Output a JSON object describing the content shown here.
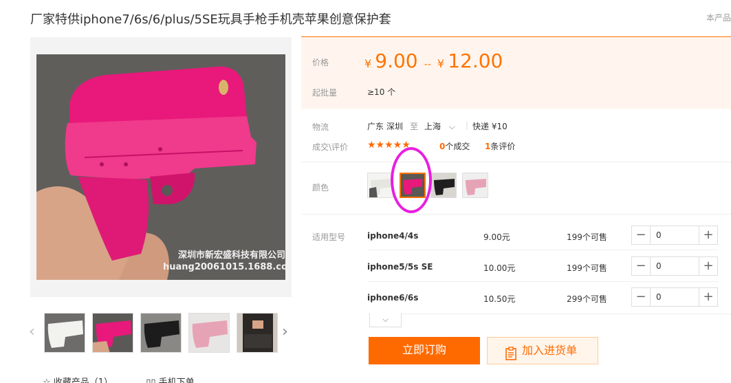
{
  "product": {
    "title": "厂家特供iphone7/6s/6/plus/5SE玩具手枪手机壳苹果创意保护套",
    "corner_note": "本产品",
    "watermark_line1": "深圳市新宏盛科技有限公司",
    "watermark_line2": "huang20061015.1688.com"
  },
  "gallery": {
    "prev_icon": "chevron-left-icon",
    "next_icon": "chevron-right-icon",
    "thumbnails": [
      "white-gun-case",
      "rose-gun-case",
      "black-gun-case",
      "pink-gun-case",
      "lifestyle-photo"
    ]
  },
  "bottom_links": {
    "favorite": "☆ 收藏产品（1）",
    "mobile_order": "▯▯ 手机下单"
  },
  "price": {
    "label": "价格",
    "currency": "¥",
    "low": "9.00",
    "separator": "--",
    "high": "12.00",
    "moq_label": "起批量",
    "moq_value": "≥10 个"
  },
  "logistics": {
    "label": "物流",
    "from": "广东 深圳",
    "to_word": "至",
    "to": "上海",
    "express": "快递 ¥10"
  },
  "deals": {
    "label": "成交\\评价",
    "stars": "★★★★★",
    "deal_count": "0",
    "deal_suffix": "个成交",
    "review_count": "1",
    "review_suffix": "条评价"
  },
  "color": {
    "label": "颜色",
    "options": [
      "white",
      "rose",
      "black",
      "pink"
    ],
    "selected_index": 1
  },
  "sku": {
    "label": "适用型号",
    "rows": [
      {
        "model": "iphone4/4s",
        "price": "9.00元",
        "stock": "199个可售",
        "qty": "0"
      },
      {
        "model": "iphone5/5s SE",
        "price": "10.00元",
        "stock": "199个可售",
        "qty": "0"
      },
      {
        "model": "iphone6/6s",
        "price": "10.50元",
        "stock": "299个可售",
        "qty": "0"
      }
    ]
  },
  "actions": {
    "buy_now": "立即订购",
    "add_to_list": "加入进货单"
  },
  "colors": {
    "accent": "#ff6a00",
    "highlight_circle": "#e81ee0",
    "case_rose": "#e8197a",
    "case_pink": "#e7a3b6"
  }
}
